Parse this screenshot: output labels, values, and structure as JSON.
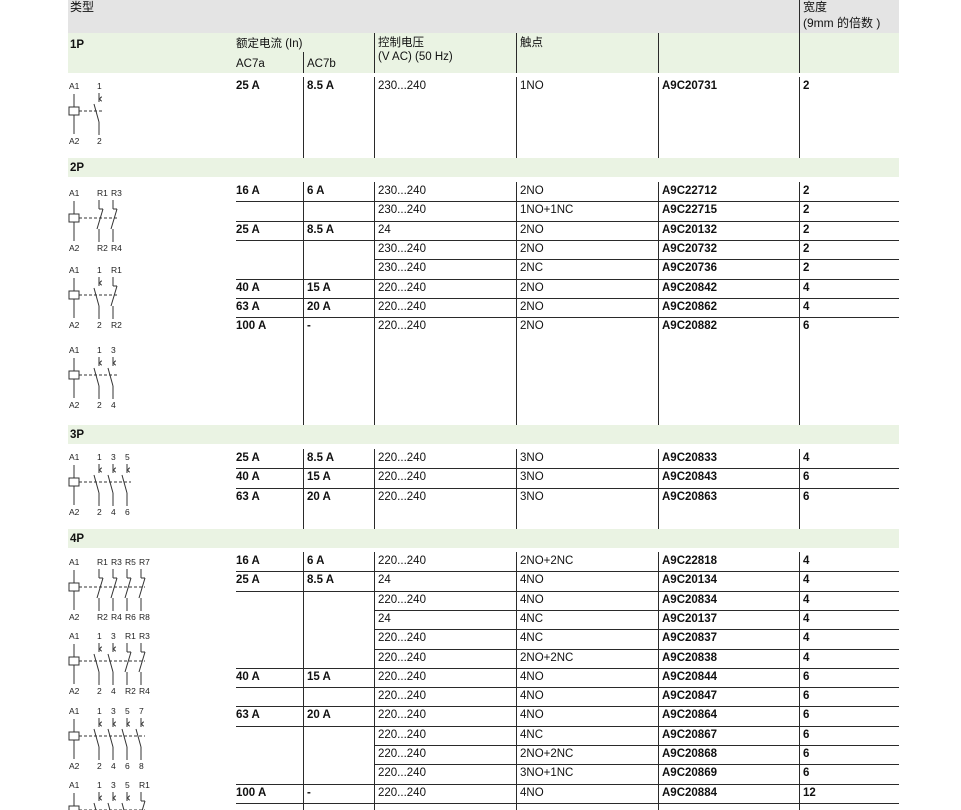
{
  "header": {
    "type": "类型",
    "width_line1": "宽度",
    "width_line2": "(9mm 的倍数 )",
    "rated_current": "额定电流 (In)",
    "ac7a": "AC7a",
    "ac7b": "AC7b",
    "control_voltage_line1": "控制电压",
    "control_voltage_line2": "(V AC) (50 Hz)",
    "contacts": "触点"
  },
  "sections": {
    "p1": "1P",
    "p2": "2P",
    "p3": "3P",
    "p4": "4P"
  },
  "rows": {
    "p1": [
      {
        "ac7a": "25 A",
        "ac7b": "8.5 A",
        "voltage": "230...240",
        "contact": "1NO",
        "ref": "A9C20731",
        "width": "2"
      }
    ],
    "p2": [
      {
        "ac7a": "16 A",
        "ac7b": "6 A",
        "voltage": "230...240",
        "contact": "2NO",
        "ref": "A9C22712",
        "width": "2"
      },
      {
        "ac7a": "",
        "ac7b": "",
        "voltage": "230...240",
        "contact": "1NO+1NC",
        "ref": "A9C22715",
        "width": "2"
      },
      {
        "ac7a": "25 A",
        "ac7b": "8.5 A",
        "voltage": "24",
        "contact": "2NO",
        "ref": "A9C20132",
        "width": "2"
      },
      {
        "ac7a": "",
        "ac7b": "",
        "voltage": "230...240",
        "contact": "2NO",
        "ref": "A9C20732",
        "width": "2"
      },
      {
        "ac7a": "",
        "ac7b": "",
        "voltage": "230...240",
        "contact": "2NC",
        "ref": "A9C20736",
        "width": "2"
      },
      {
        "ac7a": "40 A",
        "ac7b": "15 A",
        "voltage": "220...240",
        "contact": "2NO",
        "ref": "A9C20842",
        "width": "4"
      },
      {
        "ac7a": "63 A",
        "ac7b": "20 A",
        "voltage": "220...240",
        "contact": "2NO",
        "ref": "A9C20862",
        "width": "4"
      },
      {
        "ac7a": "100 A",
        "ac7b": "-",
        "voltage": "220...240",
        "contact": "2NO",
        "ref": "A9C20882",
        "width": "6"
      }
    ],
    "p3": [
      {
        "ac7a": "25 A",
        "ac7b": "8.5 A",
        "voltage": "220...240",
        "contact": "3NO",
        "ref": "A9C20833",
        "width": "4"
      },
      {
        "ac7a": "40 A",
        "ac7b": "15 A",
        "voltage": "220...240",
        "contact": "3NO",
        "ref": "A9C20843",
        "width": "6"
      },
      {
        "ac7a": "63 A",
        "ac7b": "20 A",
        "voltage": "220...240",
        "contact": "3NO",
        "ref": "A9C20863",
        "width": "6"
      }
    ],
    "p4": [
      {
        "ac7a": "16 A",
        "ac7b": "6 A",
        "voltage": "220...240",
        "contact": "2NO+2NC",
        "ref": "A9C22818",
        "width": "4"
      },
      {
        "ac7a": "25 A",
        "ac7b": "8.5 A",
        "voltage": "24",
        "contact": "4NO",
        "ref": "A9C20134",
        "width": "4"
      },
      {
        "ac7a": "",
        "ac7b": "",
        "voltage": "220...240",
        "contact": "4NO",
        "ref": "A9C20834",
        "width": "4"
      },
      {
        "ac7a": "",
        "ac7b": "",
        "voltage": "24",
        "contact": "4NC",
        "ref": "A9C20137",
        "width": "4"
      },
      {
        "ac7a": "",
        "ac7b": "",
        "voltage": "220...240",
        "contact": "4NC",
        "ref": "A9C20837",
        "width": "4"
      },
      {
        "ac7a": "",
        "ac7b": "",
        "voltage": "220...240",
        "contact": "2NO+2NC",
        "ref": "A9C20838",
        "width": "4"
      },
      {
        "ac7a": "40 A",
        "ac7b": "15 A",
        "voltage": "220...240",
        "contact": "4NO",
        "ref": "A9C20844",
        "width": "6"
      },
      {
        "ac7a": "",
        "ac7b": "",
        "voltage": "220...240",
        "contact": "4NO",
        "ref": "A9C20847",
        "width": "6"
      },
      {
        "ac7a": "63 A",
        "ac7b": "20 A",
        "voltage": "220...240",
        "contact": "4NO",
        "ref": "A9C20864",
        "width": "6"
      },
      {
        "ac7a": "",
        "ac7b": "",
        "voltage": "220...240",
        "contact": "4NC",
        "ref": "A9C20867",
        "width": "6"
      },
      {
        "ac7a": "",
        "ac7b": "",
        "voltage": "220...240",
        "contact": "2NO+2NC",
        "ref": "A9C20868",
        "width": "6"
      },
      {
        "ac7a": "",
        "ac7b": "",
        "voltage": "220...240",
        "contact": "3NO+1NC",
        "ref": "A9C20869",
        "width": "6"
      },
      {
        "ac7a": "100 A",
        "ac7b": "-",
        "voltage": "220...240",
        "contact": "4NO",
        "ref": "A9C20884",
        "width": "12"
      }
    ]
  },
  "diagrams": {
    "d1": {
      "top": [
        "A1",
        "1"
      ],
      "bottom": [
        "A2",
        "2"
      ]
    },
    "d2": {
      "top": [
        "A1",
        "R1",
        "R3"
      ],
      "bottom": [
        "A2",
        "R2",
        "R4"
      ]
    },
    "d3": {
      "top": [
        "A1",
        "1",
        "R1"
      ],
      "bottom": [
        "A2",
        "2",
        "R2"
      ]
    },
    "d4": {
      "top": [
        "A1",
        "1",
        "3"
      ],
      "bottom": [
        "A2",
        "2",
        "4"
      ]
    },
    "d5": {
      "top": [
        "A1",
        "1",
        "3",
        "5"
      ],
      "bottom": [
        "A2",
        "2",
        "4",
        "6"
      ]
    },
    "d6": {
      "top": [
        "A1",
        "R1",
        "R3",
        "R5",
        "R7"
      ],
      "bottom": [
        "A2",
        "R2",
        "R4",
        "R6",
        "R8"
      ]
    },
    "d7": {
      "top": [
        "A1",
        "1",
        "3",
        "R1",
        "R3"
      ],
      "bottom": [
        "A2",
        "2",
        "4",
        "R2",
        "R4"
      ]
    },
    "d8": {
      "top": [
        "A1",
        "1",
        "3",
        "5",
        "7"
      ],
      "bottom": [
        "A2",
        "2",
        "4",
        "6",
        "8"
      ]
    },
    "d9": {
      "top": [
        "A1",
        "1",
        "3",
        "5",
        "R1"
      ],
      "bottom": []
    }
  },
  "colors": {
    "band": "#eaf3e3",
    "header_band": "#e3e3e3",
    "rule": "#2a2a2a"
  }
}
